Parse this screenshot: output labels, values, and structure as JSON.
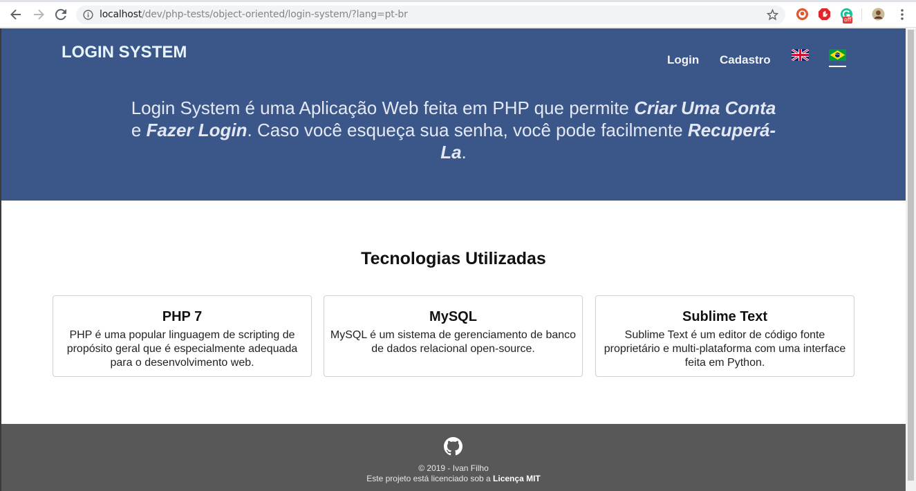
{
  "browser": {
    "url_host": "localhost",
    "url_path": "/dev/php-tests/object-oriented/login-system/?lang=pt-br",
    "extension_badge": "off"
  },
  "header": {
    "brand": "LOGIN SYSTEM",
    "nav": {
      "login": "Login",
      "register": "Cadastro"
    },
    "languages": [
      "english-flag",
      "brazil-flag"
    ],
    "active_language": "pt-br"
  },
  "hero": {
    "part1": "Login System é uma Aplicação Web feita em PHP que permite ",
    "emph1": "Criar Uma Conta",
    "part2": " e ",
    "emph2": "Fazer Login",
    "part3": ". Caso você esqueça sua senha, você pode facilmente ",
    "emph3": "Recuperá-La",
    "part4": "."
  },
  "technologies": {
    "title": "Tecnologias Utilizadas",
    "cards": [
      {
        "title": "PHP 7",
        "text": "PHP é uma popular linguagem de scripting de propósito geral que é especialmente adequada para o desenvolvimento web."
      },
      {
        "title": "MySQL",
        "text": "MySQL é um sistema de gerenciamento de banco de dados relacional open-source."
      },
      {
        "title": "Sublime Text",
        "text": "Sublime Text é um editor de código fonte proprietário e multi-plataforma com uma interface feita em Python."
      }
    ]
  },
  "footer": {
    "copyright": "© 2019 - Ivan Filho",
    "license_prefix": "Este projeto está licenciado sob a ",
    "license_link": "Licença MIT"
  },
  "colors": {
    "hero_bg": "#3b5789",
    "footer_bg": "#585858",
    "brand_text": "#e6f5ff"
  }
}
